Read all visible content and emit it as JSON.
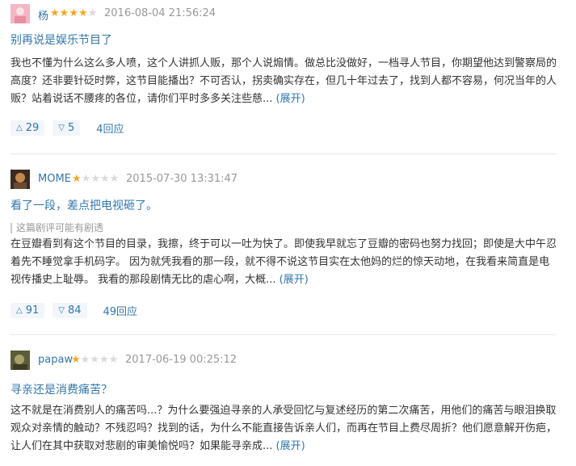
{
  "reviews": [
    {
      "author": "杨",
      "rating": 4,
      "time": "2016-08-04 21:56:24",
      "title": "别再说是娱乐节目了",
      "spoiler": "",
      "body": "我也不懂为什么这么多人喷，这个人讲抓人贩，那个人说煽情。做总比没做好，一档寻人节目，你期望他达到警察局的高度？还非要针砭时弊，这节目能播出？不可否认，拐卖确实存在，但几十年过去了，找到人都不容易，何况当年的人贩？站着说话不腰疼的各位，请你们平时多多关注些慈...",
      "expand": "(展开)",
      "up": "29",
      "down": "5",
      "replies": "4回应"
    },
    {
      "author": "MOME",
      "rating": 1,
      "time": "2015-07-30 13:31:47",
      "title": "看了一段，差点把电视砸了。",
      "spoiler": "这篇剧评可能有剧透",
      "body": "在豆瓣看到有这个节目的目录，我擦，终于可以一吐为快了。即使我早就忘了豆瓣的密码也努力找回；即使是大中午忍着先不睡觉拿手机码字。 因为就凭我看的那一段，就不得不说这节目实在太他妈的烂的惊天动地，在我看来简直是电视传播史上耻辱。 我看的那段剧情无比的虐心啊，大概...",
      "expand": "(展开)",
      "up": "91",
      "down": "84",
      "replies": "49回应"
    },
    {
      "author": "papaw",
      "rating": 1,
      "time": "2017-06-19 00:25:12",
      "title": "寻亲还是消费痛苦？",
      "spoiler": "",
      "body": "这不就是在消费别人的痛苦吗...？为什么要强迫寻亲的人承受回忆与复述经历的第二次痛苦，用他们的痛苦与眼泪换取观众对亲情的触动？不残忍吗？找到的话，为什么不能直接告诉亲人们，而再在节目上费尽周折？他们愿意解开伤疤，让人们在其中获取对悲剧的审美愉悦吗？如果能寻亲成...",
      "expand": "(展开)",
      "up": "",
      "down": "",
      "replies": ""
    }
  ],
  "icons": {
    "up": "triangle-up-icon",
    "down": "triangle-down-icon",
    "star": "star-icon"
  },
  "colors": {
    "link": "#3377aa",
    "star": "#f5a623",
    "muted": "#999999"
  }
}
